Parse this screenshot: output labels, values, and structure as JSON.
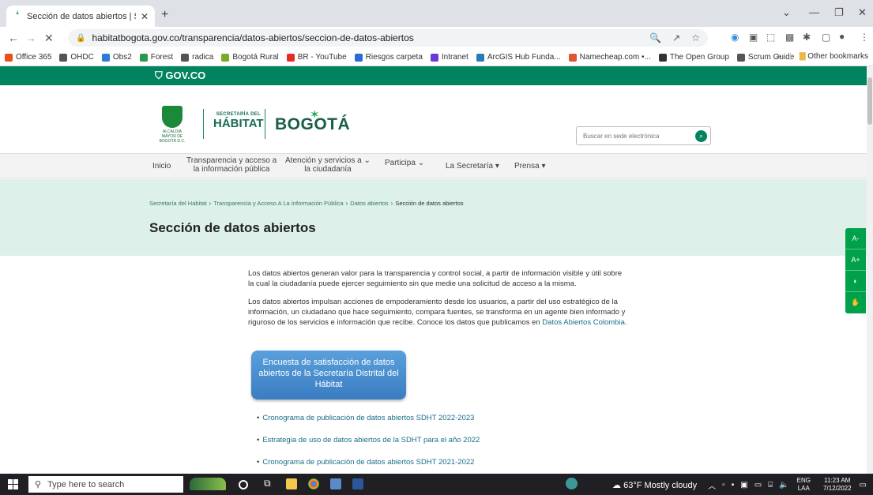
{
  "browser": {
    "tab_title": "Sección de datos abiertos | Secre",
    "url": "habitatbogota.gov.co/transparencia/datos-abiertos/seccion-de-datos-abiertos",
    "new_tab_symbol": "+",
    "bookmarks": [
      {
        "label": "Office 365",
        "color": "#e6511c"
      },
      {
        "label": "OHDC",
        "color": "#555555"
      },
      {
        "label": "Obs2",
        "color": "#2e7bd6"
      },
      {
        "label": "Forest",
        "color": "#2a9a4a"
      },
      {
        "label": "radica",
        "color": "#555555"
      },
      {
        "label": "Bogotá Rural",
        "color": "#7aaa2a"
      },
      {
        "label": "BR - YouTube",
        "color": "#e52d27"
      },
      {
        "label": "Riesgos carpeta",
        "color": "#2a6ad6"
      },
      {
        "label": "Intranet",
        "color": "#6a3ad6"
      },
      {
        "label": "ArcGIS Hub Funda...",
        "color": "#2a7ab6"
      },
      {
        "label": "Namecheap.com •...",
        "color": "#de5833"
      },
      {
        "label": "The Open Group",
        "color": "#333333"
      },
      {
        "label": "Scrum Guide",
        "color": "#555555"
      }
    ],
    "other_bookmarks": "Other bookmarks",
    "more_bookmarks": "»"
  },
  "site": {
    "gov_label": "GOV.CO",
    "escudo_caption": "ALCALDÍA MAYOR DE BOGOTÁ D.C.",
    "secretaria_small": "SECRETARÍA DEL",
    "secretaria_big": "HÁBITAT",
    "bogota": "BOGOTÁ",
    "search_placeholder": "Buscar en sede electrónica",
    "nav": [
      {
        "line1": "Inicio",
        "line2": ""
      },
      {
        "line1": "Transparencia y acceso a",
        "line2": "la información pública"
      },
      {
        "line1": "Atención y servicios a",
        "line2": "la ciudadanía"
      },
      {
        "line1": "Participa",
        "line2": ""
      },
      {
        "line1": "La Secretaría",
        "line2": ""
      },
      {
        "line1": "Prensa",
        "line2": ""
      }
    ],
    "breadcrumb": [
      "Secretaría del Habitat",
      "Transparencia y Acceso A La Información Pública",
      "Datos abiertos",
      "Sección de datos abiertos"
    ],
    "page_title": "Sección de datos abiertos",
    "para1": "Los datos abiertos generan valor para la transparencia y control social, a partir de información visible y útil sobre la cual la ciudadanía puede ejercer seguimiento sin que medie una solicitud de acceso a la misma.",
    "para2_text": "Los datos abiertos impulsan acciones de empoderamiento desde los usuarios, a partir del uso estratégico de la información, un ciudadano que hace seguimiento, compara fuentes, se transforma en un agente bien informado y riguroso de los servicios e información que recibe. Conoce los datos que publicamos en ",
    "para2_link": "Datos Abiertos Colombia.",
    "cta": "Encuesta de satisfacción de datos abiertos de la Secretaría Distrital del Hábitat",
    "links": [
      "Cronograma de publicación de datos abiertos SDHT 2022-2023",
      "Estrategia de uso de datos abiertos de la SDHT para el año 2022",
      "Cronograma de publicación de datos abiertos SDHT 2021-2022"
    ],
    "a11y": [
      "A-",
      "A+",
      "◐",
      "✋"
    ]
  },
  "taskbar": {
    "search_placeholder": "Type here to search",
    "weather": "63°F  Mostly cloudy",
    "lang1": "ENG",
    "lang2": "LAA",
    "time": "11:23 AM",
    "date": "7/12/2022"
  },
  "colors": {
    "gov_green": "#00835e",
    "banner_bg": "#ddf0e9",
    "link": "#1a6e8a",
    "cta_blue": "#3a7cc2",
    "a11y_green": "#00a14b"
  }
}
